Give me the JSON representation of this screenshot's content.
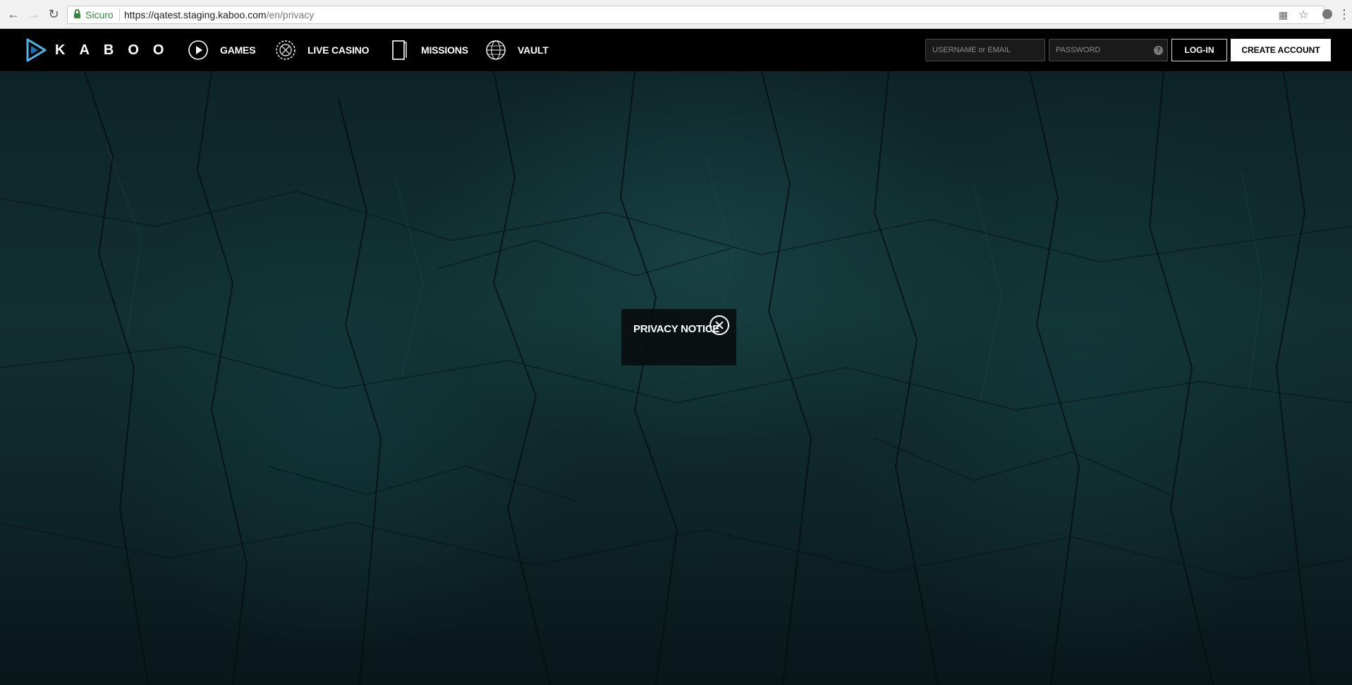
{
  "browser": {
    "secure_label": "Sicuro",
    "url_host": "https://qatest.staging.kaboo.com",
    "url_path": "/en/privacy",
    "icons": [
      "back-icon",
      "forward-icon",
      "reload-icon",
      "lock-icon",
      "translate-icon",
      "star-icon",
      "extension-icon",
      "menu-icon"
    ]
  },
  "header": {
    "logo_text": "KABOO",
    "nav": [
      {
        "label": "GAMES",
        "icon": "play-icon"
      },
      {
        "label": "LIVE CASINO",
        "icon": "chip-icon"
      },
      {
        "label": "MISSIONS",
        "icon": "card-icon"
      },
      {
        "label": "VAULT",
        "icon": "globe-icon"
      }
    ],
    "username_placeholder": "USERNAME or EMAIL",
    "password_placeholder": "PASSWORD",
    "help_glyph": "?",
    "login_label": "LOG-IN",
    "create_label": "CREATE ACCOUNT"
  },
  "modal": {
    "title": "PRIVACY NOTICE",
    "close_icon": "close-icon"
  },
  "colors": {
    "header_bg": "#000000",
    "hero_bg": "#0d2427",
    "logo_accent": "#4fb6e8",
    "secure_green": "#2e8b3e"
  }
}
